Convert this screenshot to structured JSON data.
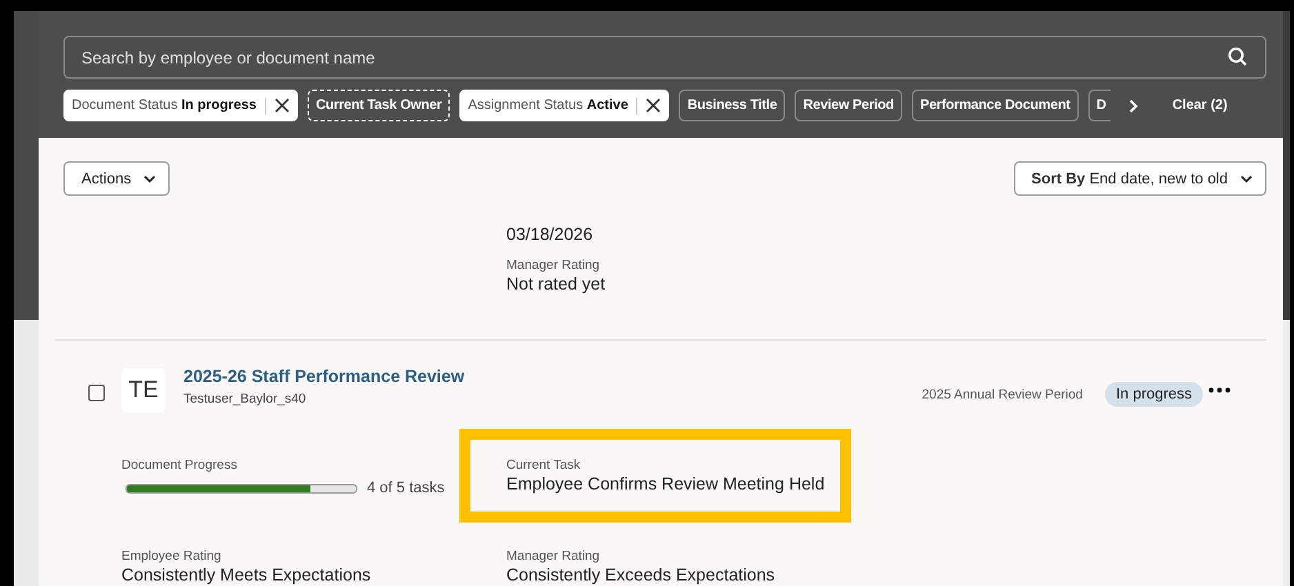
{
  "search": {
    "placeholder": "Search by employee or document name"
  },
  "filters": [
    {
      "kind": "applied",
      "label": "Document Status",
      "value": "In progress",
      "focused": false
    },
    {
      "kind": "available",
      "label": "Current Task Owner",
      "focused": true
    },
    {
      "kind": "applied",
      "label": "Assignment Status",
      "value": "Active",
      "focused": false
    },
    {
      "kind": "available",
      "label": "Business Title",
      "focused": false
    },
    {
      "kind": "available",
      "label": "Review Period",
      "focused": false
    },
    {
      "kind": "available",
      "label": "Performance Document",
      "focused": false
    },
    {
      "kind": "available",
      "label": "D",
      "focused": false
    }
  ],
  "clear_button": "Clear (2)",
  "actions_button": "Actions",
  "sort": {
    "label": "Sort By",
    "value": "End date, new to old"
  },
  "previous_record": {
    "current_task_lines": [
      "03/18/2026"
    ],
    "manager_rating": {
      "label": "Manager Rating",
      "value": "Not rated yet"
    }
  },
  "record": {
    "selected": false,
    "initials": "TE",
    "title": "2025-26 Staff Performance Review",
    "employee": "Testuser_Baylor_s40",
    "period": "2025 Annual Review Period",
    "status": "In progress",
    "progress": {
      "label": "Document Progress",
      "level": 0.8,
      "reading": "4 of 5 tasks"
    },
    "current_task": {
      "label": "Current Task",
      "value": "Employee Confirms Review Meeting Held",
      "highlighted": true
    },
    "employee_rating": {
      "label": "Employee Rating",
      "value": "Consistently Meets Expectations"
    },
    "manager_rating": {
      "label": "Manager Rating",
      "value": "Consistently Exceeds Expectations"
    }
  }
}
